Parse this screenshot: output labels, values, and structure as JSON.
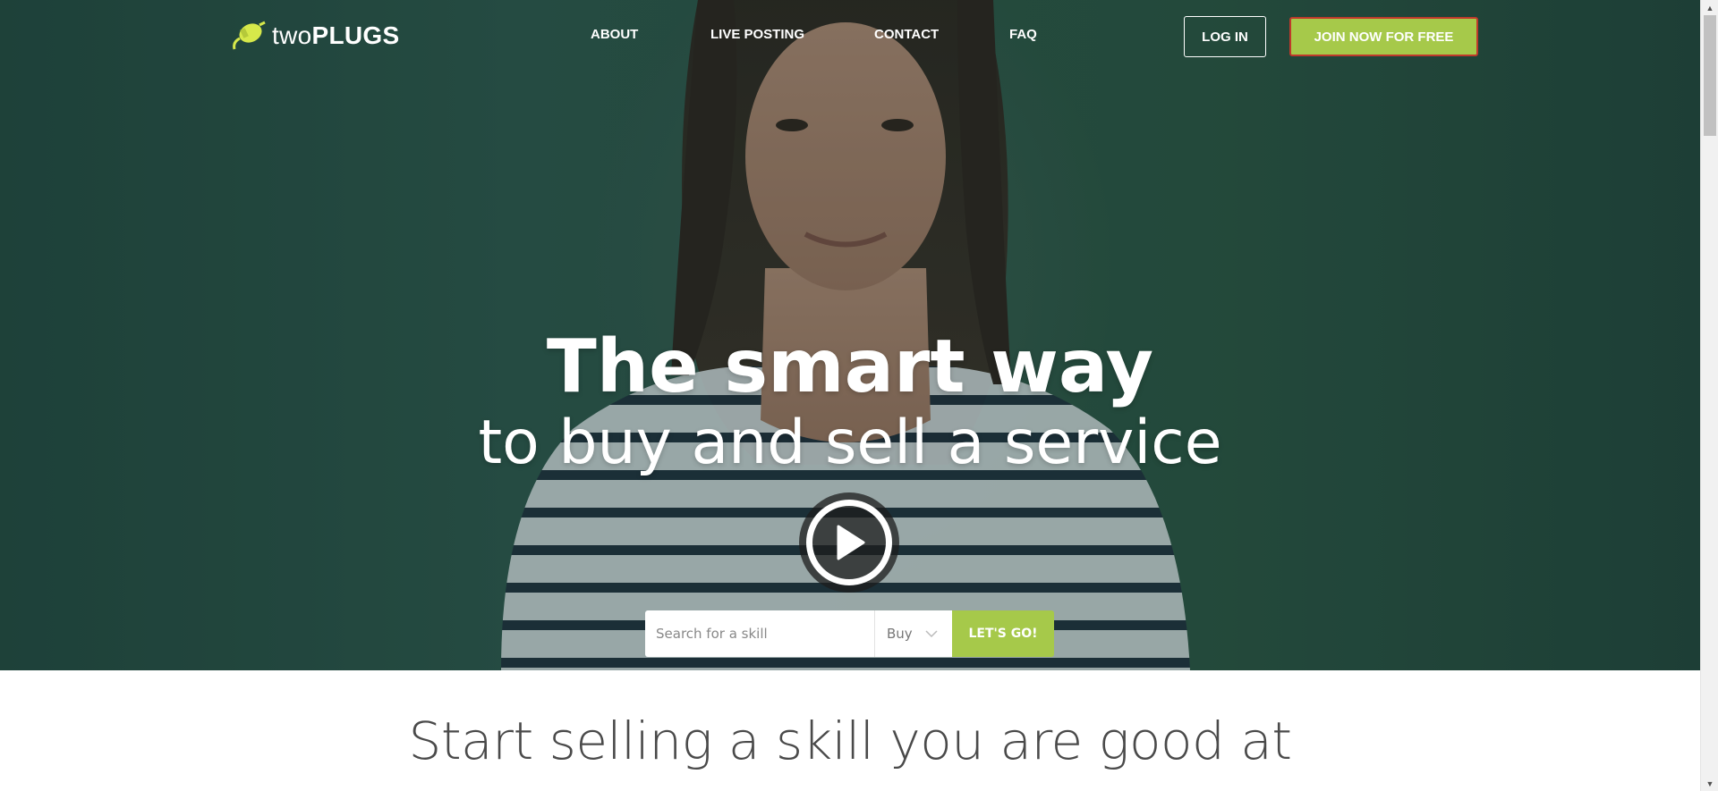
{
  "nav": {
    "logo_prefix": "two",
    "logo_suffix": "PLUGS",
    "links": [
      {
        "label": "ABOUT"
      },
      {
        "label": "LIVE POSTING"
      },
      {
        "label": "CONTACT"
      },
      {
        "label": "FAQ"
      }
    ],
    "login_label": "LOG IN",
    "join_label": "JOIN NOW FOR FREE"
  },
  "hero": {
    "headline": "The smart way",
    "subheadline": "to buy and sell a service",
    "play_icon": "play-icon"
  },
  "search": {
    "placeholder": "Search for a skill",
    "mode_value": "Buy",
    "submit_label": "LET'S GO!"
  },
  "section": {
    "title": "Start selling a skill you are good at"
  },
  "colors": {
    "accent": "#a6c94a",
    "hero_bg": "#2a5248",
    "join_border": "#c0392b"
  }
}
